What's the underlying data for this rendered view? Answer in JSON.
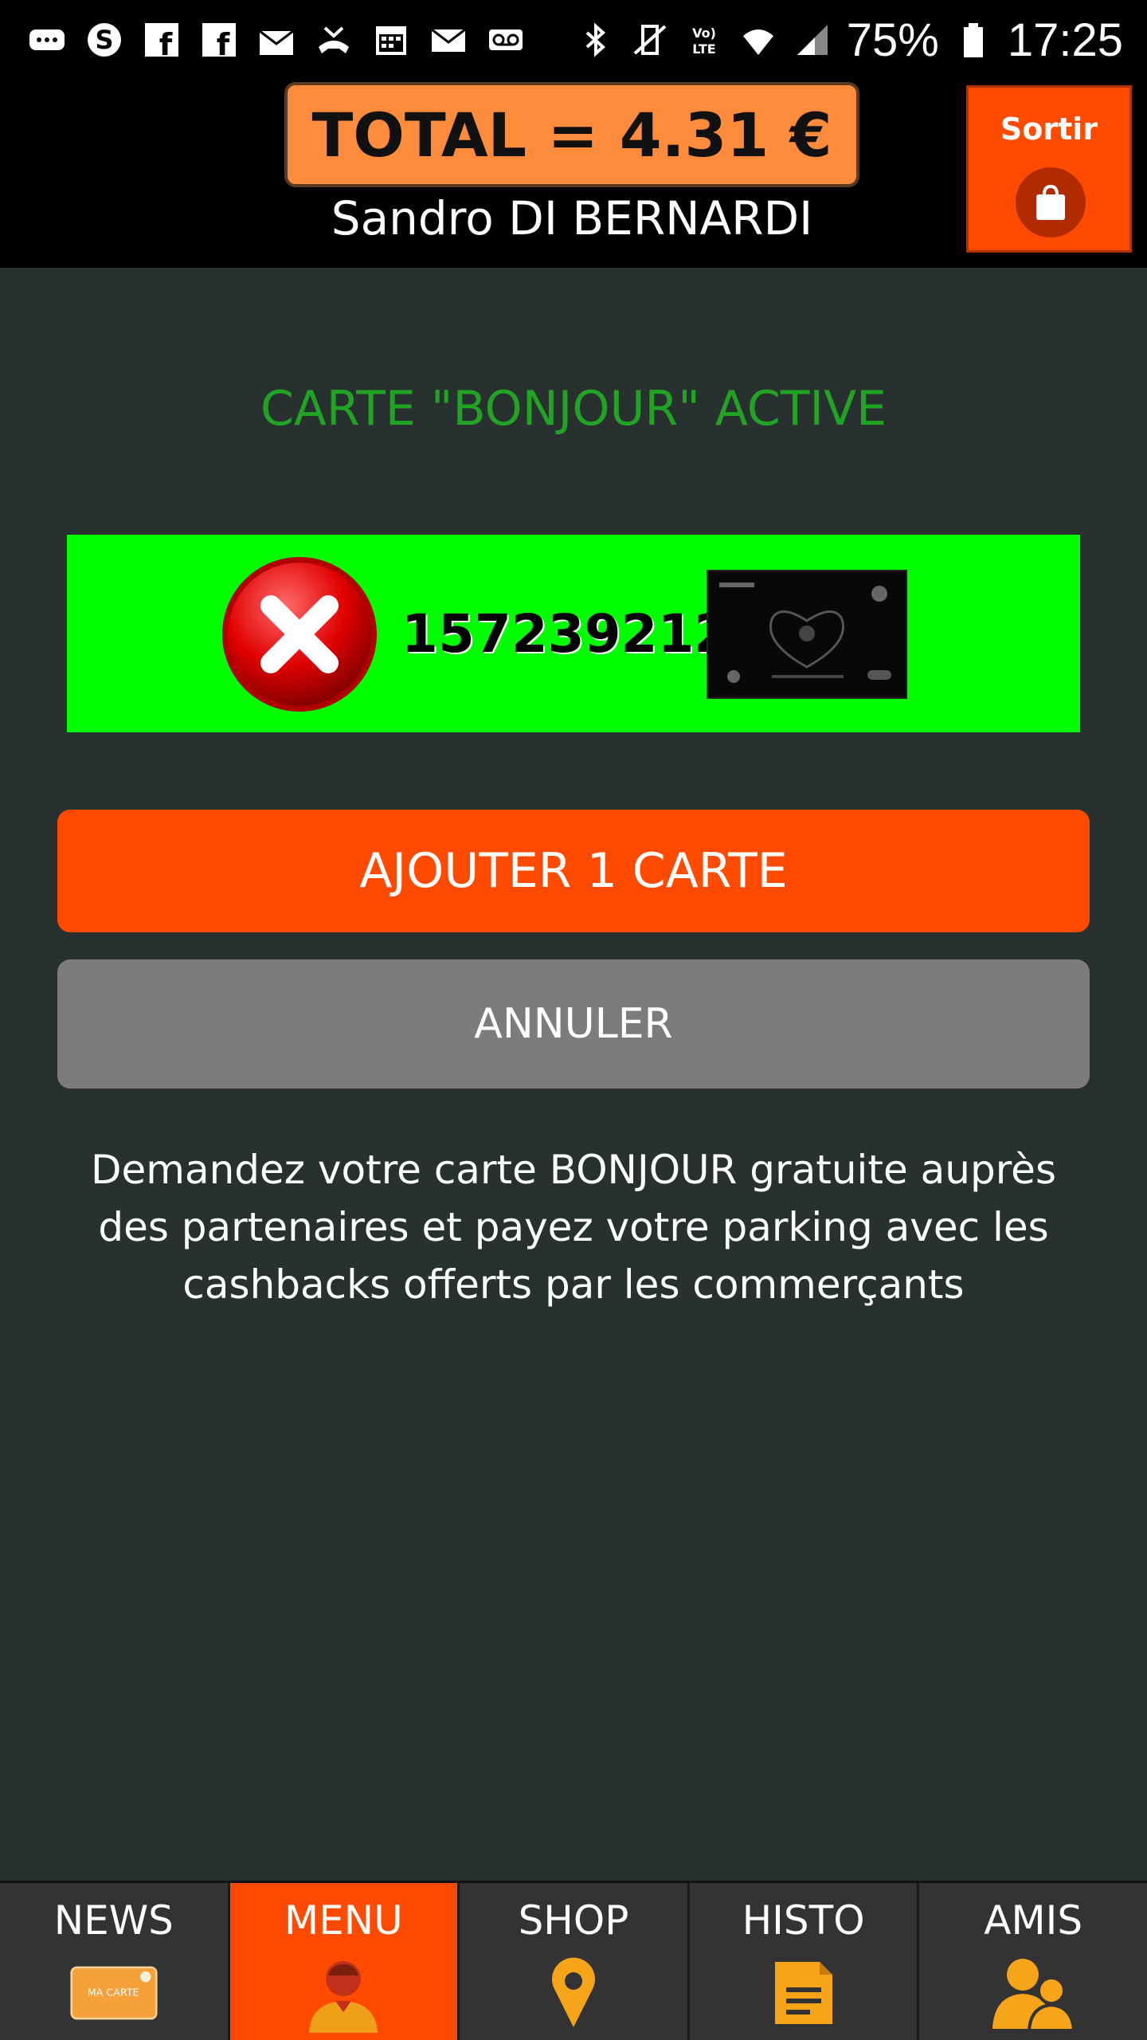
{
  "status_bar": {
    "battery": "75%",
    "time": "17:25",
    "network": "VoLTE"
  },
  "header": {
    "total": "TOTAL = 4.31 €",
    "user_name": "Sandro DI BERNARDI",
    "exit_label": "Sortir"
  },
  "main": {
    "status_title": "CARTE \"BONJOUR\" ACTIVE",
    "card": {
      "number": "1572392127"
    },
    "add_button": "AJOUTER 1 CARTE",
    "cancel_button": "ANNULER",
    "info": "Demandez votre carte BONJOUR gratuite auprès des partenaires et payez votre parking avec les cashbacks offerts par les commerçants"
  },
  "nav": {
    "items": [
      {
        "label": "NEWS",
        "icon": "card-icon",
        "badge": "MA CARTE"
      },
      {
        "label": "MENU",
        "icon": "user-icon"
      },
      {
        "label": "SHOP",
        "icon": "map-pin-icon"
      },
      {
        "label": "HISTO",
        "icon": "document-icon"
      },
      {
        "label": "AMIS",
        "icon": "friends-icon"
      }
    ],
    "active_index": 1
  },
  "colors": {
    "accent": "#ff4a00",
    "total_bg": "#ff8c3c",
    "active_green": "#21a324",
    "card_row_bg": "#00ff00",
    "cancel_bg": "#7c7c7c",
    "page_bg": "#293030"
  }
}
